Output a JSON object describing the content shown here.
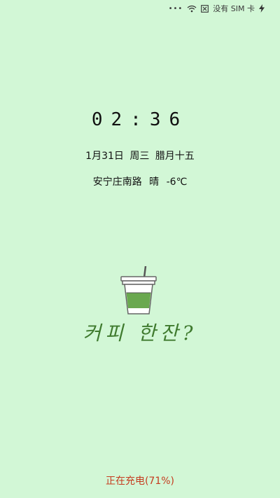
{
  "status_bar": {
    "dots": "•••",
    "sim_text": "没有 SIM 卡",
    "icons": [
      "wifi-icon",
      "no-sim-icon",
      "charging-bolt-icon"
    ]
  },
  "lock_screen": {
    "time": "02:36",
    "date": "1月31日",
    "weekday": "周三",
    "lunar": "腊月十五",
    "location": "安宁庄南路",
    "weather": "晴",
    "temperature": "-6℃",
    "korean_text": "커피 한잔?",
    "charging_status": "正在充电(71%)"
  },
  "colors": {
    "background": "#d2f7d6",
    "cup_green": "#6aa84f",
    "korean_green": "#3f7a2e",
    "charging_red": "#c53c1f"
  }
}
